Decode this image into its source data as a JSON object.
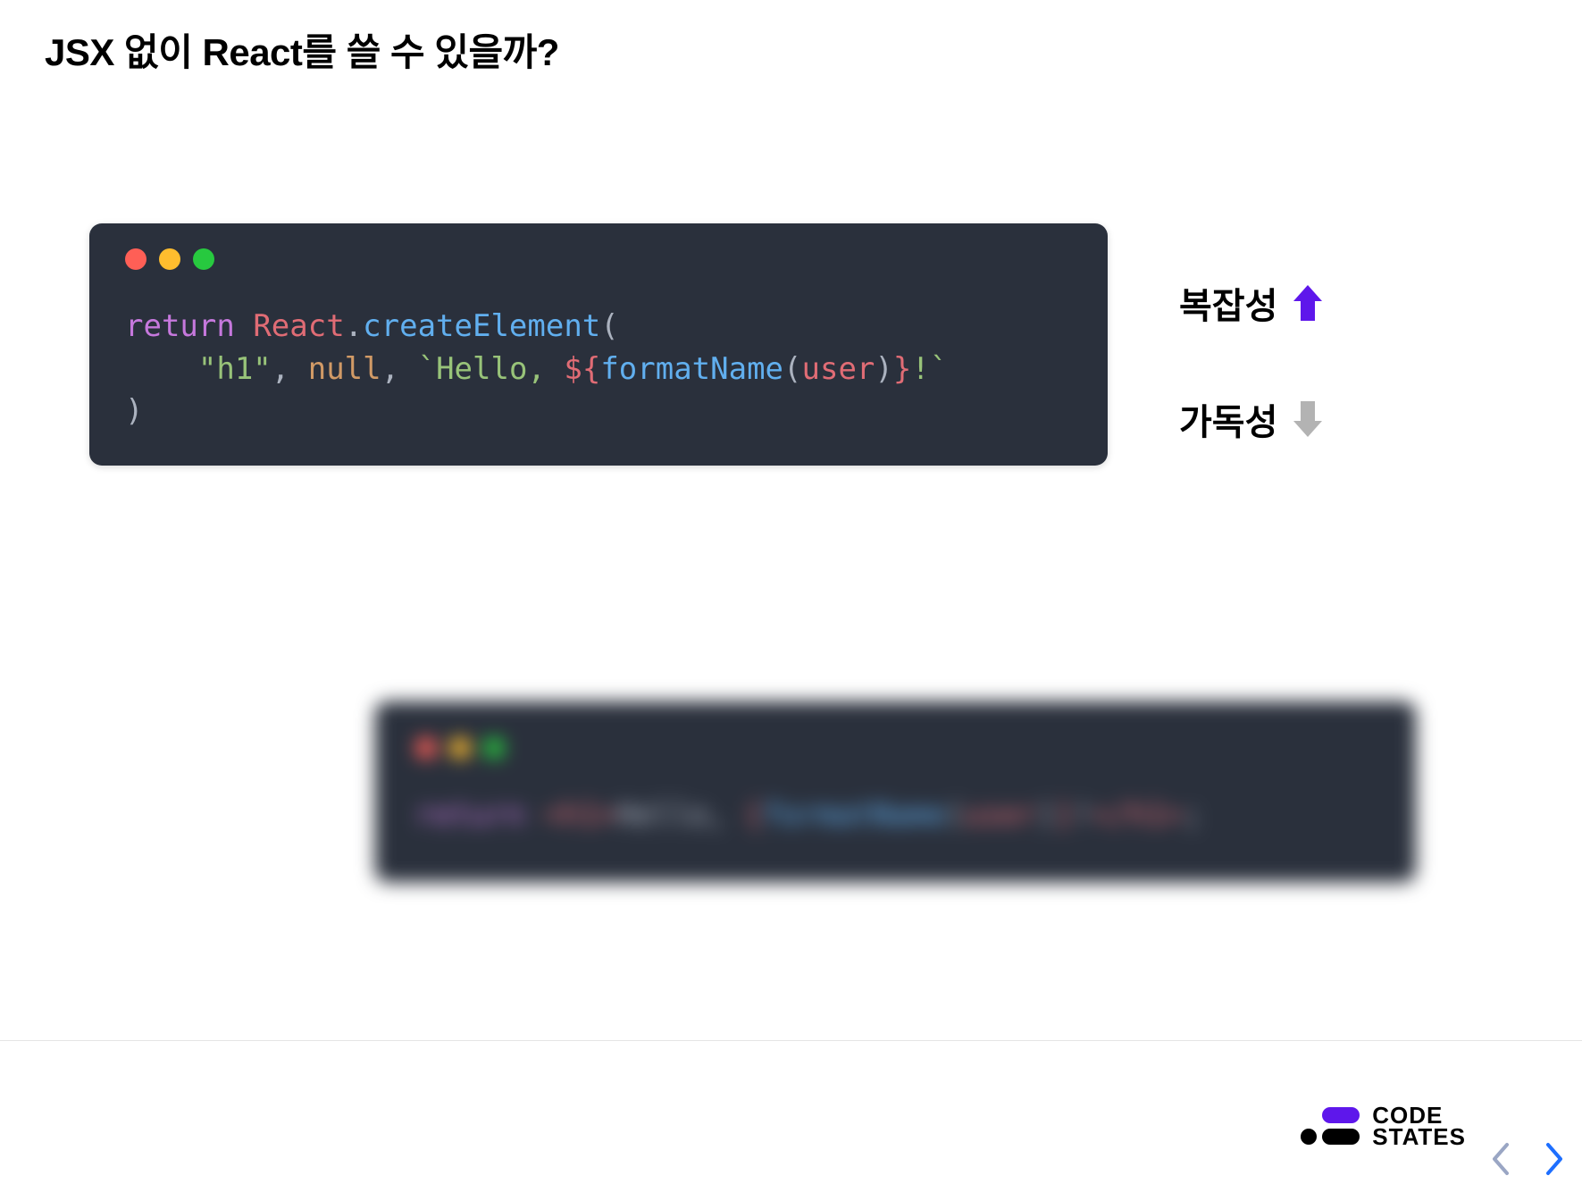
{
  "title": "JSX 없이 React를 쓸 수 있을까?",
  "code1": {
    "tokens": {
      "return": "return",
      "React": "React",
      "dot": ".",
      "createElement": "createElement",
      "lparen": "(",
      "indent": "    ",
      "h1": "\"h1\"",
      "comma1": ", ",
      "null": "null",
      "comma2": ", ",
      "backtick1": "`",
      "hello": "Hello, ",
      "dollar": "${",
      "formatName": "formatName",
      "lparen2": "(",
      "user": "user",
      "rparen2": ")",
      "rbrace": "}",
      "excl": "!",
      "backtick2": "`",
      "rparen": ")"
    }
  },
  "code2": {
    "tokens": {
      "return": "return",
      "openTag": "<h1>",
      "hello": "Hello, ",
      "lbrace": "{",
      "formatName": "formatName",
      "lparen": "(",
      "user": "user",
      "rparen": ")",
      "rbrace": "}",
      "excl": "!",
      "closeTag": "</h1>",
      "semi": ";"
    }
  },
  "annotations": {
    "complexity": "복잡성",
    "readability": "가독성"
  },
  "logo": {
    "line1": "CODE",
    "line2": "STATES"
  },
  "colors": {
    "arrowUp": "#5e17eb",
    "arrowDown": "#b3b3b3"
  }
}
